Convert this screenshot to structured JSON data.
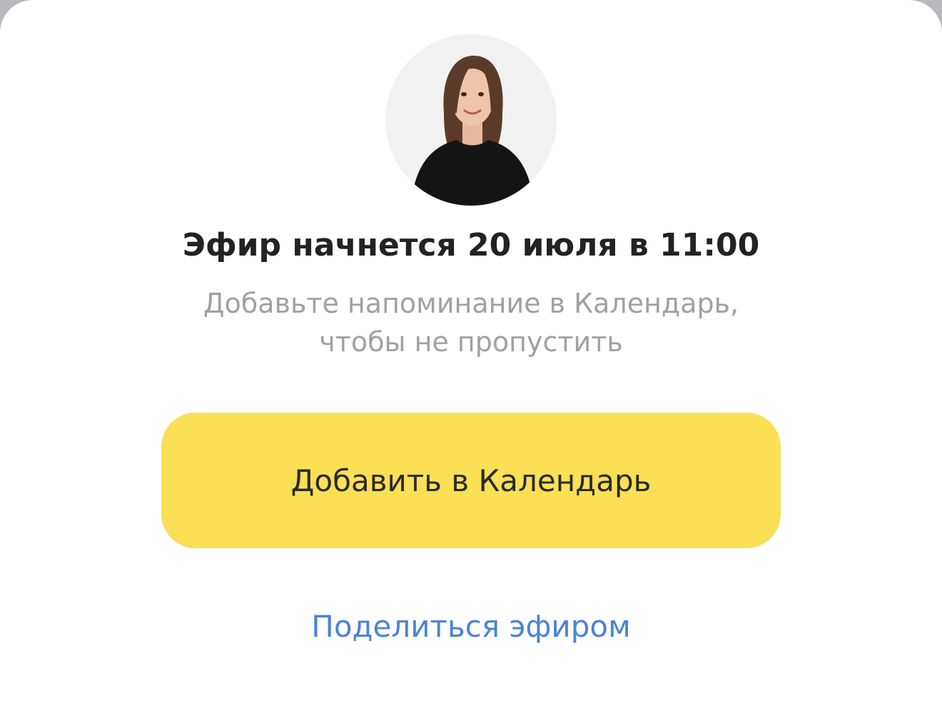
{
  "modal": {
    "title": "Эфир начнется 20 июля в 11:00",
    "subtitle_line1": "Добавьте напоминание в Календарь,",
    "subtitle_line2": "чтобы не пропустить",
    "primary_button_label": "Добавить в Календарь",
    "share_link_label": "Поделиться эфиром"
  },
  "colors": {
    "primary_button": "#fbdf55",
    "link": "#4b83d8",
    "title": "#222222",
    "subtitle": "#a0a0a5"
  }
}
